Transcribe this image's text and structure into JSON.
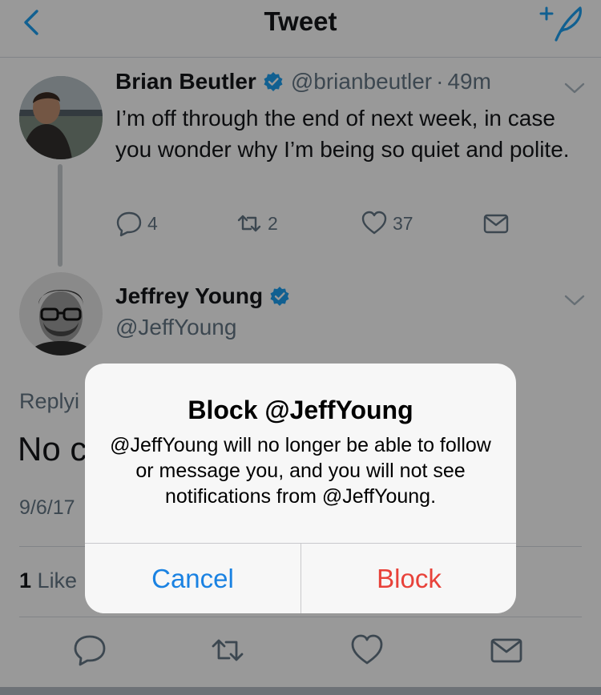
{
  "nav": {
    "title": "Tweet",
    "back_icon": "chevron-left-icon",
    "compose_icon": "compose-tweet-icon"
  },
  "tweet": {
    "author_name": "Brian Beutler",
    "author_handle": "@brianbeutler",
    "separator": "·",
    "time": "49m",
    "text": "I’m off through the end of next week, in case you wonder why I’m being so quiet and polite.",
    "reply_count": "4",
    "retweet_count": "2",
    "like_count": "37"
  },
  "reply": {
    "author_name": "Jeffrey Young",
    "author_handle": "@JeffYoung",
    "replying_label": "Replyi",
    "text_fragment": "No c",
    "date_fragment": "9/6/17",
    "likes_count": "1",
    "likes_label": "Like"
  },
  "alert": {
    "title": "Block @JeffYoung",
    "message": "@JeffYoung will no longer be able to follow or message you, and you will not see notifications from @JeffYoung.",
    "cancel_label": "Cancel",
    "block_label": "Block"
  },
  "colors": {
    "verified": "#1da1f2",
    "link_blue": "#1a82e2",
    "destructive_red": "#e8423a",
    "secondary_text": "#657786"
  }
}
